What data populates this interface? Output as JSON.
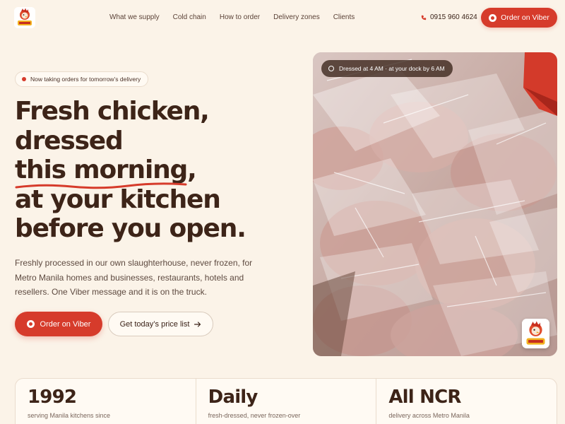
{
  "nav": {
    "links": [
      "What we supply",
      "Cold chain",
      "How to order",
      "Delivery zones",
      "Clients"
    ],
    "phone": "0915 960 4624",
    "cta_label": "Order on Viber",
    "logo_icon": "rooster-logo-icon"
  },
  "hero": {
    "badge": "Now taking orders for tomorrow’s delivery",
    "headline_lines": [
      "Fresh chicken,",
      "dressed",
      "this morning,",
      "at your kitchen",
      "before you open."
    ],
    "lede": "Freshly processed in our own slaughterhouse, never frozen, for Metro Manila homes and businesses, restaurants, hotels and resellers. One Viber message and it is on the truck.",
    "primary_cta": "Order on Viber",
    "secondary_cta": "Get today’s price list",
    "secondary_cta_icon": "arrow-right-icon"
  },
  "photo": {
    "chip": "Dressed at 4 AM · at your dock by 6 AM",
    "chip_icon": "snowflake-icon"
  },
  "stats": [
    {
      "value": "1992",
      "label": "serving Manila kitchens since"
    },
    {
      "value": "Daily",
      "label": "fresh-dressed, never frozen-over"
    },
    {
      "value": "All NCR",
      "label": "delivery across Metro Manila"
    }
  ],
  "colors": {
    "accent": "#d63b2b",
    "background": "#fbf3e8",
    "text": "#3d2418"
  }
}
